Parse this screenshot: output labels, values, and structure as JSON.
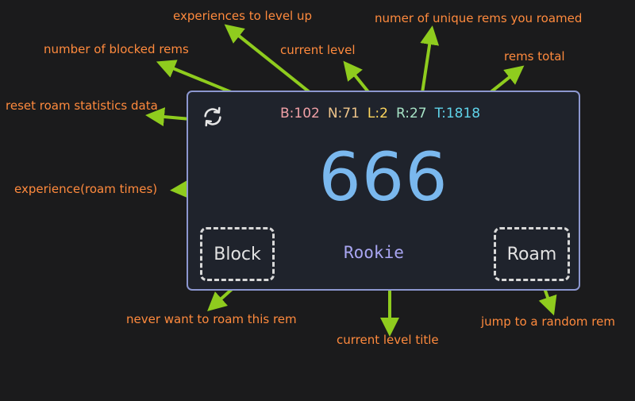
{
  "widget": {
    "stats": {
      "blocked": "B:102",
      "next_level": "N:71",
      "level": "L:2",
      "roamed": "R:27",
      "total": "T:1818"
    },
    "experience": "666",
    "block_label": "Block",
    "roam_label": "Roam",
    "level_title": "Rookie",
    "reset_icon": "refresh-icon"
  },
  "colors": {
    "blocked": "#f0a0a6",
    "next_level": "#eec48a",
    "level": "#ffd75e",
    "roamed": "#a7e3c6",
    "total": "#5fd3ea",
    "experience": "#7ab8ee",
    "level_title": "#a9a6f2",
    "annotation": "#ff8a3d",
    "arrow": "#8fcc1e"
  },
  "annotations": {
    "experiences_to_level_up": "experiences to level up",
    "unique_rems": "numer of unique rems you roamed",
    "blocked_rems": "number of blocked rems",
    "current_level": "current level",
    "rems_total": "rems total",
    "reset": "reset roam statistics data",
    "experience": "experience(roam times)",
    "never_roam": "never want to roam this rem",
    "level_title": "current level title",
    "jump": "jump to a random rem"
  }
}
